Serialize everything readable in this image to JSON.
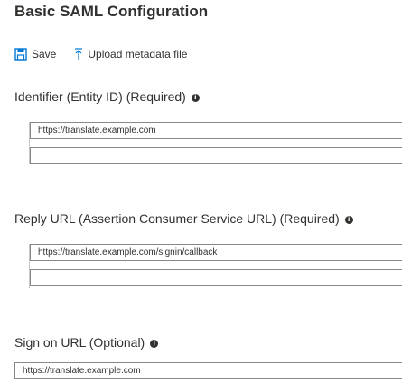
{
  "panel": {
    "title": "Basic SAML Configuration"
  },
  "toolbar": {
    "save_label": "Save",
    "upload_label": "Upload metadata file",
    "save_icon": "save-icon",
    "upload_icon": "upload-icon"
  },
  "identifier": {
    "label": "Identifier (Entity ID) (Required)",
    "values": [
      "https://translate.example.com",
      ""
    ]
  },
  "reply_url": {
    "label": "Reply URL (Assertion Consumer Service URL) (Required)",
    "values": [
      "https://translate.example.com/signin/callback",
      ""
    ]
  },
  "sign_on_url": {
    "label": "Sign on URL (Optional)",
    "value": "https://translate.example.com"
  },
  "colors": {
    "accent": "#0078d4",
    "text": "#323130",
    "border": "#8a8886"
  }
}
